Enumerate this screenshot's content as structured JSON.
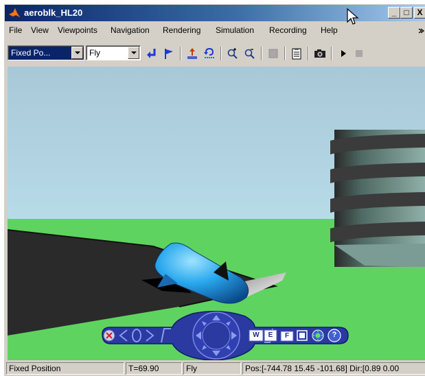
{
  "window": {
    "title": "aeroblk_HL20",
    "min_label": "_",
    "max_label": "□",
    "close_label": "X"
  },
  "menu": {
    "items": [
      "File",
      "View",
      "Viewpoints",
      "Navigation",
      "Rendering",
      "Simulation",
      "Recording",
      "Help"
    ]
  },
  "toolbar": {
    "viewpoint_value": "Fixed Po...",
    "navigation_mode": "Fly",
    "icons": [
      "return-arrow-icon",
      "flag-icon",
      "straighten-up-icon",
      "undo-move-icon",
      "zoom-in-icon",
      "zoom-out-icon",
      "headlight-icon",
      "clipboard-icon",
      "camera-icon",
      "play-icon",
      "stop-icon"
    ]
  },
  "nav_panel": {
    "w_label": "W",
    "e_label": "E",
    "f_label": "F",
    "help_label": "?"
  },
  "statusbar": {
    "viewpoint": "Fixed Position",
    "time": "T=69.90",
    "mode": "Fly",
    "position": "Pos:[-744.78 15.45 -101.68] Dir:[0.89 0.00"
  },
  "colors": {
    "title_bar_start": "#0a246a",
    "sky": "#add8e6",
    "ground": "#5fd35f",
    "runway": "#2a2a2a",
    "aircraft": "#2da6e8",
    "nav_panel": "#2a3aa0"
  }
}
